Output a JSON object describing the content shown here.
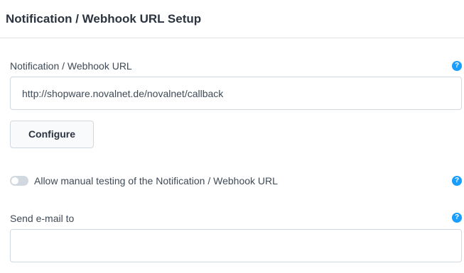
{
  "card": {
    "title": "Notification / Webhook URL Setup"
  },
  "webhook_url": {
    "label": "Notification / Webhook URL",
    "value": "http://shopware.novalnet.de/novalnet/callback",
    "help_icon": "question-circle-icon"
  },
  "configure_button": {
    "label": "Configure"
  },
  "manual_testing": {
    "label": "Allow manual testing of the Notification / Webhook URL",
    "enabled": false,
    "help_icon": "question-circle-icon"
  },
  "send_email": {
    "label": "Send e-mail to",
    "value": "",
    "help_icon": "question-circle-icon"
  },
  "colors": {
    "accent": "#189eff",
    "text": "#2b3440",
    "border": "#d1d8e0"
  }
}
